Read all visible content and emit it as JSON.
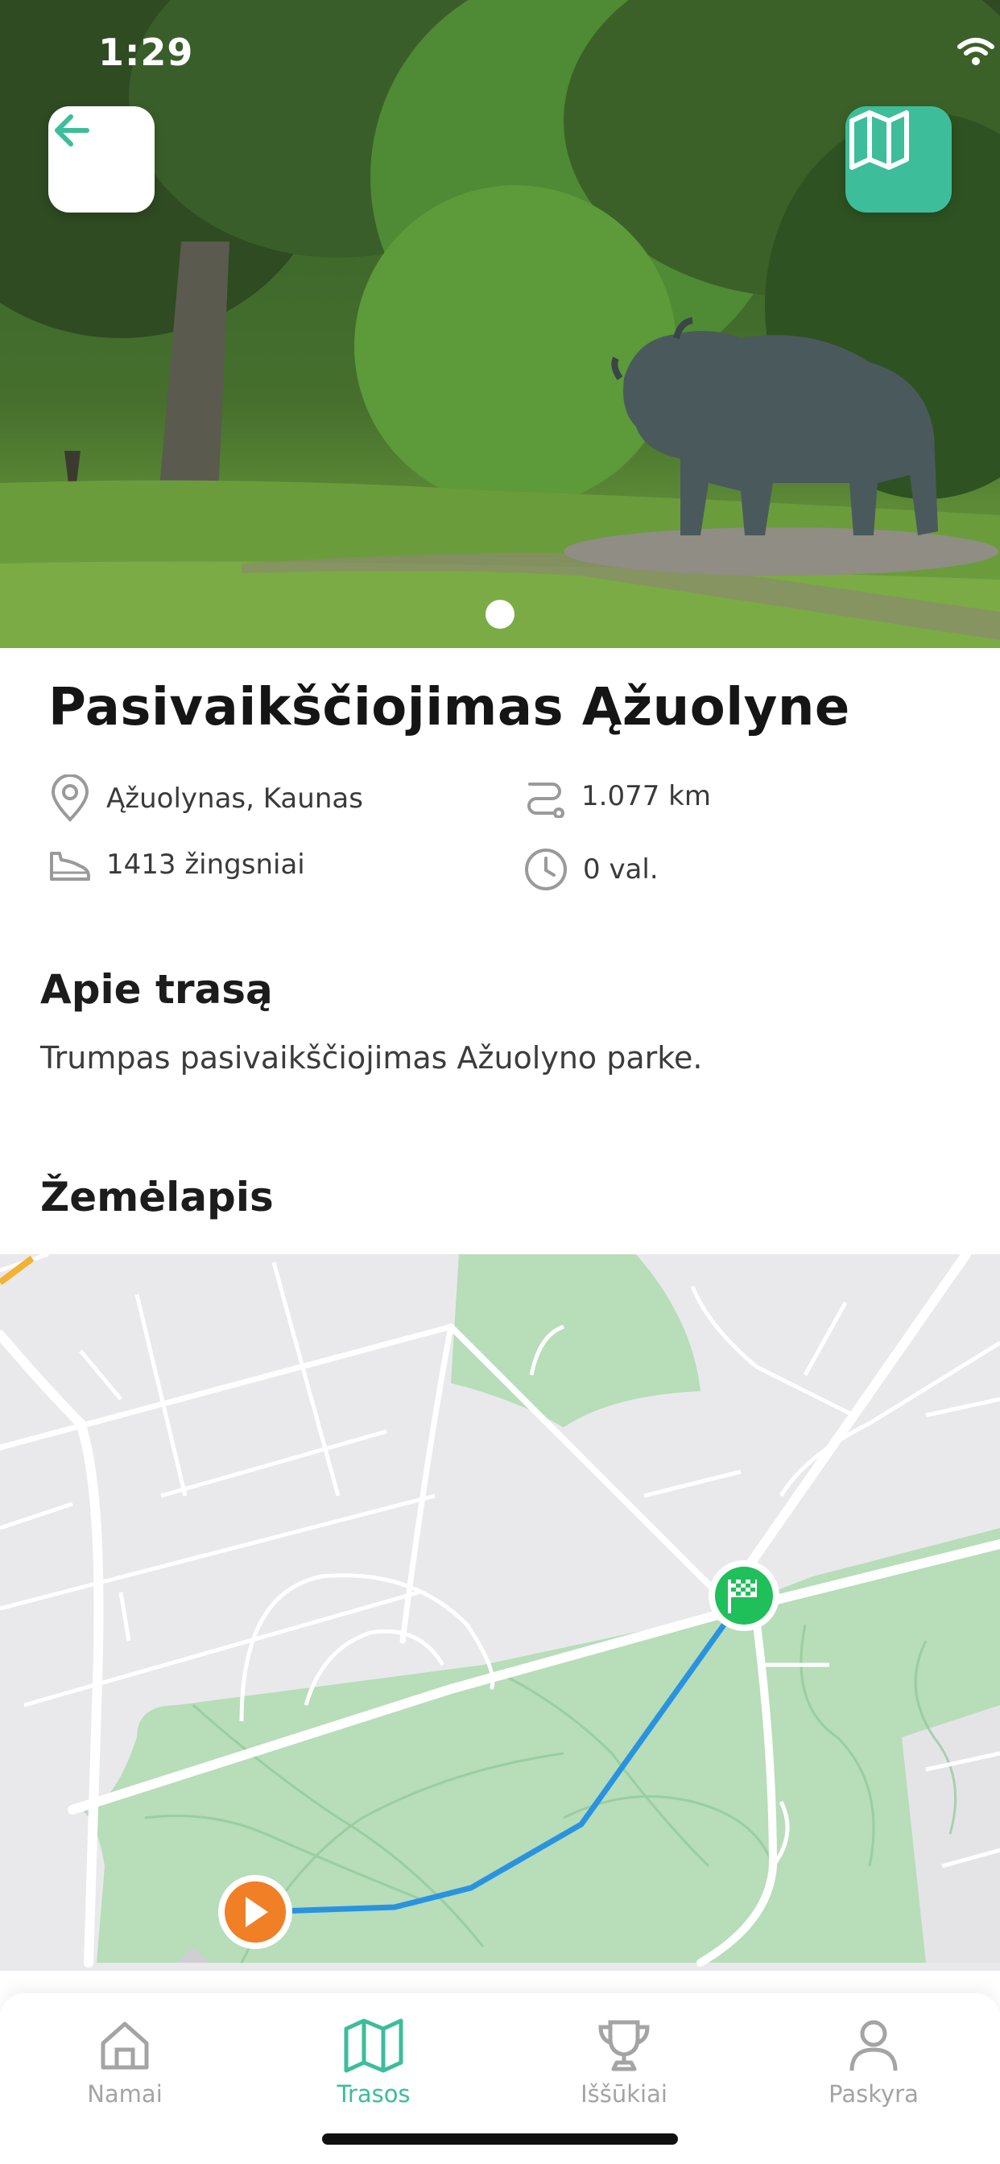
{
  "status_bar": {
    "time": "1:29"
  },
  "hero": {
    "page_count": 1,
    "active_page": 1
  },
  "route": {
    "title": "Pasivaikščiojimas Ąžuolyne",
    "location": "Ąžuolynas, Kaunas",
    "distance": "1.077 km",
    "steps": "1413 žingsniai",
    "duration": "0 val."
  },
  "about": {
    "heading": "Apie trasą",
    "text": "Trumpas pasivaikščiojimas Ažuolyno parke."
  },
  "map": {
    "heading": "Žemėlapis",
    "start_marker_color": "#f07f26",
    "finish_marker_color": "#1fbf5a",
    "route_color": "#2a93e0",
    "park_color": "#b7ddb9"
  },
  "tabs": [
    {
      "label": "Namai",
      "icon": "home-icon",
      "active": false
    },
    {
      "label": "Trasos",
      "icon": "map-icon",
      "active": true
    },
    {
      "label": "Iššūkiai",
      "icon": "trophy-icon",
      "active": false
    },
    {
      "label": "Paskyra",
      "icon": "person-icon",
      "active": false
    }
  ],
  "colors": {
    "accent": "#3dbd9a",
    "inactive": "#a4a4a4"
  }
}
